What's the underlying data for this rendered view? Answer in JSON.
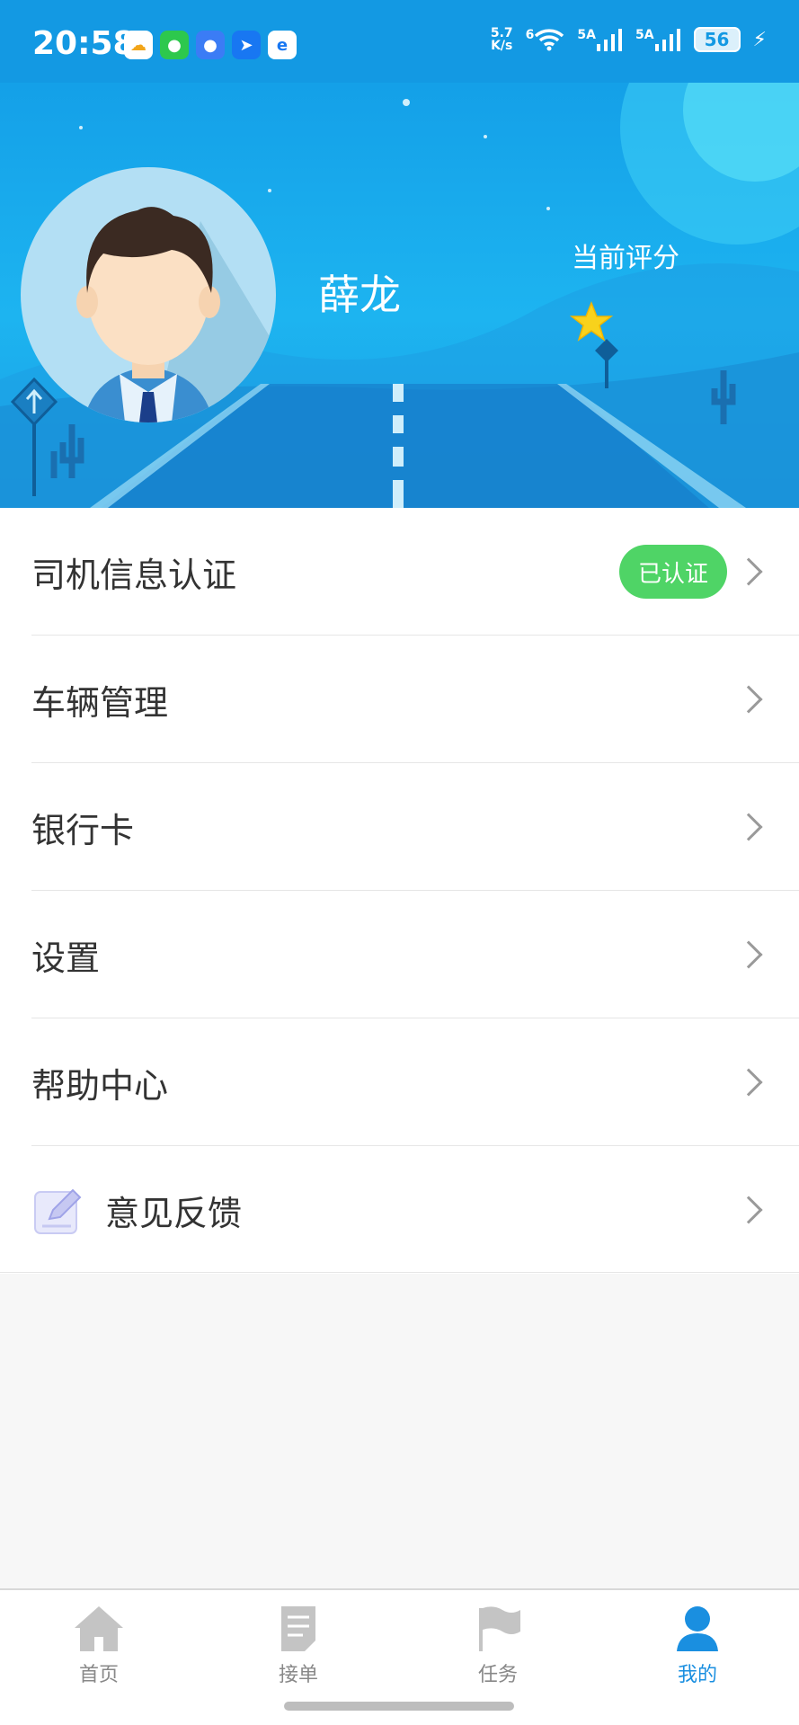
{
  "status_bar": {
    "time": "20:58",
    "net_speed_value": "5.7",
    "net_speed_unit": "K/s",
    "wifi_label": "6",
    "signal1_label": "5A",
    "signal2_label": "5A",
    "battery": "56",
    "notification_icons": [
      "cloud-app-icon",
      "wechat-icon",
      "message-icon",
      "navigation-app-icon",
      "browser-app-icon"
    ]
  },
  "profile": {
    "name": "薛龙",
    "rating_label": "当前评分",
    "rating_stars": 1
  },
  "menu": {
    "items": [
      {
        "label": "司机信息认证",
        "badge": "已认证"
      },
      {
        "label": "车辆管理"
      },
      {
        "label": "银行卡"
      },
      {
        "label": "设置"
      },
      {
        "label": "帮助中心"
      },
      {
        "label": "意见反馈",
        "icon": "edit-icon"
      }
    ]
  },
  "tabbar": {
    "tabs": [
      {
        "label": "首页",
        "icon": "home-icon"
      },
      {
        "label": "接单",
        "icon": "document-icon"
      },
      {
        "label": "任务",
        "icon": "flag-icon"
      },
      {
        "label": "我的",
        "icon": "user-icon",
        "active": true
      }
    ]
  },
  "colors": {
    "primary": "#1399e3",
    "badge_green": "#4fd466",
    "active_tab": "#1a8fe0"
  }
}
